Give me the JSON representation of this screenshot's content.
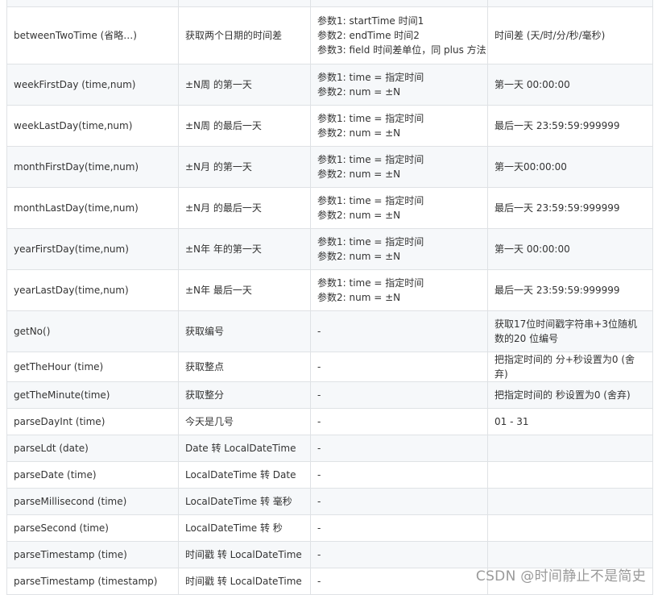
{
  "rows": [
    {
      "method": "",
      "desc": "",
      "params": [],
      "result": ""
    },
    {
      "method": "betweenTwoTime (省略…)",
      "desc": "获取两个日期的时间差",
      "params": [
        "参数1: startTime 时间1",
        "参数2: endTime 时间2",
        "参数3: field 时间差单位，同 plus 方法"
      ],
      "result": "时间差 (天/时/分/秒/毫秒)"
    },
    {
      "method": "weekFirstDay (time,num)",
      "desc": "±N周 的第一天",
      "params": [
        "参数1: time = 指定时间",
        "参数2: num = ±N"
      ],
      "result": "第一天 00:00:00"
    },
    {
      "method": "weekLastDay(time,num)",
      "desc": "±N周 的最后一天",
      "params": [
        "参数1: time = 指定时间",
        "参数2: num = ±N"
      ],
      "result": "最后一天 23:59:59:999999"
    },
    {
      "method": "monthFirstDay(time,num)",
      "desc": "±N月 的第一天",
      "params": [
        "参数1: time = 指定时间",
        "参数2: num = ±N"
      ],
      "result": "第一天00:00:00"
    },
    {
      "method": "monthLastDay(time,num)",
      "desc": "±N月 的最后一天",
      "params": [
        "参数1: time = 指定时间",
        "参数2: num = ±N"
      ],
      "result": "最后一天 23:59:59:999999"
    },
    {
      "method": "yearFirstDay(time,num)",
      "desc": "±N年 年的第一天",
      "params": [
        "参数1: time = 指定时间",
        "参数2: num = ±N"
      ],
      "result": "第一天 00:00:00"
    },
    {
      "method": "yearLastDay(time,num)",
      "desc": "±N年 最后一天",
      "params": [
        "参数1: time = 指定时间",
        "参数2: num = ±N"
      ],
      "result": "最后一天 23:59:59:999999"
    },
    {
      "method": "getNo()",
      "desc": "获取编号",
      "params": [
        "-"
      ],
      "result": "获取17位时间戳字符串+3位随机数的20 位编号"
    },
    {
      "method": "getTheHour (time)",
      "desc": "获取整点",
      "params": [
        "-"
      ],
      "result": "把指定时间的 分+秒设置为0 (舍弃)"
    },
    {
      "method": "getTheMinute(time)",
      "desc": "获取整分",
      "params": [
        "-"
      ],
      "result": "把指定时间的 秒设置为0 (舍弃)"
    },
    {
      "method": "parseDayInt (time)",
      "desc": "今天是几号",
      "params": [
        "-"
      ],
      "result": "01 - 31"
    },
    {
      "method": "parseLdt (date)",
      "desc": "Date 转 LocalDateTime",
      "params": [
        "-"
      ],
      "result": ""
    },
    {
      "method": "parseDate (time)",
      "desc": "LocalDateTime 转 Date",
      "params": [
        "-"
      ],
      "result": ""
    },
    {
      "method": "parseMillisecond (time)",
      "desc": "LocalDateTime 转 毫秒",
      "params": [
        "-"
      ],
      "result": ""
    },
    {
      "method": "parseSecond (time)",
      "desc": "LocalDateTime 转 秒",
      "params": [
        "-"
      ],
      "result": ""
    },
    {
      "method": "parseTimestamp (time)",
      "desc": "时间戳 转 LocalDateTime",
      "params": [
        "-"
      ],
      "result": ""
    },
    {
      "method": "parseTimestamp (timestamp)",
      "desc": "时间戳 转 LocalDateTime",
      "params": [
        "-"
      ],
      "result": ""
    }
  ],
  "watermark": "CSDN @时间静止不是简史"
}
